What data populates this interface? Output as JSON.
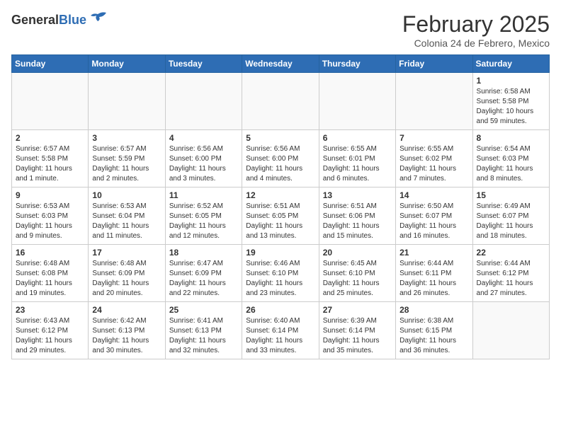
{
  "header": {
    "logo_general": "General",
    "logo_blue": "Blue",
    "month_title": "February 2025",
    "subtitle": "Colonia 24 de Febrero, Mexico"
  },
  "weekdays": [
    "Sunday",
    "Monday",
    "Tuesday",
    "Wednesday",
    "Thursday",
    "Friday",
    "Saturday"
  ],
  "weeks": [
    [
      {
        "day": "",
        "info": ""
      },
      {
        "day": "",
        "info": ""
      },
      {
        "day": "",
        "info": ""
      },
      {
        "day": "",
        "info": ""
      },
      {
        "day": "",
        "info": ""
      },
      {
        "day": "",
        "info": ""
      },
      {
        "day": "1",
        "info": "Sunrise: 6:58 AM\nSunset: 5:58 PM\nDaylight: 10 hours and 59 minutes."
      }
    ],
    [
      {
        "day": "2",
        "info": "Sunrise: 6:57 AM\nSunset: 5:58 PM\nDaylight: 11 hours and 1 minute."
      },
      {
        "day": "3",
        "info": "Sunrise: 6:57 AM\nSunset: 5:59 PM\nDaylight: 11 hours and 2 minutes."
      },
      {
        "day": "4",
        "info": "Sunrise: 6:56 AM\nSunset: 6:00 PM\nDaylight: 11 hours and 3 minutes."
      },
      {
        "day": "5",
        "info": "Sunrise: 6:56 AM\nSunset: 6:00 PM\nDaylight: 11 hours and 4 minutes."
      },
      {
        "day": "6",
        "info": "Sunrise: 6:55 AM\nSunset: 6:01 PM\nDaylight: 11 hours and 6 minutes."
      },
      {
        "day": "7",
        "info": "Sunrise: 6:55 AM\nSunset: 6:02 PM\nDaylight: 11 hours and 7 minutes."
      },
      {
        "day": "8",
        "info": "Sunrise: 6:54 AM\nSunset: 6:03 PM\nDaylight: 11 hours and 8 minutes."
      }
    ],
    [
      {
        "day": "9",
        "info": "Sunrise: 6:53 AM\nSunset: 6:03 PM\nDaylight: 11 hours and 9 minutes."
      },
      {
        "day": "10",
        "info": "Sunrise: 6:53 AM\nSunset: 6:04 PM\nDaylight: 11 hours and 11 minutes."
      },
      {
        "day": "11",
        "info": "Sunrise: 6:52 AM\nSunset: 6:05 PM\nDaylight: 11 hours and 12 minutes."
      },
      {
        "day": "12",
        "info": "Sunrise: 6:51 AM\nSunset: 6:05 PM\nDaylight: 11 hours and 13 minutes."
      },
      {
        "day": "13",
        "info": "Sunrise: 6:51 AM\nSunset: 6:06 PM\nDaylight: 11 hours and 15 minutes."
      },
      {
        "day": "14",
        "info": "Sunrise: 6:50 AM\nSunset: 6:07 PM\nDaylight: 11 hours and 16 minutes."
      },
      {
        "day": "15",
        "info": "Sunrise: 6:49 AM\nSunset: 6:07 PM\nDaylight: 11 hours and 18 minutes."
      }
    ],
    [
      {
        "day": "16",
        "info": "Sunrise: 6:48 AM\nSunset: 6:08 PM\nDaylight: 11 hours and 19 minutes."
      },
      {
        "day": "17",
        "info": "Sunrise: 6:48 AM\nSunset: 6:09 PM\nDaylight: 11 hours and 20 minutes."
      },
      {
        "day": "18",
        "info": "Sunrise: 6:47 AM\nSunset: 6:09 PM\nDaylight: 11 hours and 22 minutes."
      },
      {
        "day": "19",
        "info": "Sunrise: 6:46 AM\nSunset: 6:10 PM\nDaylight: 11 hours and 23 minutes."
      },
      {
        "day": "20",
        "info": "Sunrise: 6:45 AM\nSunset: 6:10 PM\nDaylight: 11 hours and 25 minutes."
      },
      {
        "day": "21",
        "info": "Sunrise: 6:44 AM\nSunset: 6:11 PM\nDaylight: 11 hours and 26 minutes."
      },
      {
        "day": "22",
        "info": "Sunrise: 6:44 AM\nSunset: 6:12 PM\nDaylight: 11 hours and 27 minutes."
      }
    ],
    [
      {
        "day": "23",
        "info": "Sunrise: 6:43 AM\nSunset: 6:12 PM\nDaylight: 11 hours and 29 minutes."
      },
      {
        "day": "24",
        "info": "Sunrise: 6:42 AM\nSunset: 6:13 PM\nDaylight: 11 hours and 30 minutes."
      },
      {
        "day": "25",
        "info": "Sunrise: 6:41 AM\nSunset: 6:13 PM\nDaylight: 11 hours and 32 minutes."
      },
      {
        "day": "26",
        "info": "Sunrise: 6:40 AM\nSunset: 6:14 PM\nDaylight: 11 hours and 33 minutes."
      },
      {
        "day": "27",
        "info": "Sunrise: 6:39 AM\nSunset: 6:14 PM\nDaylight: 11 hours and 35 minutes."
      },
      {
        "day": "28",
        "info": "Sunrise: 6:38 AM\nSunset: 6:15 PM\nDaylight: 11 hours and 36 minutes."
      },
      {
        "day": "",
        "info": ""
      }
    ]
  ]
}
